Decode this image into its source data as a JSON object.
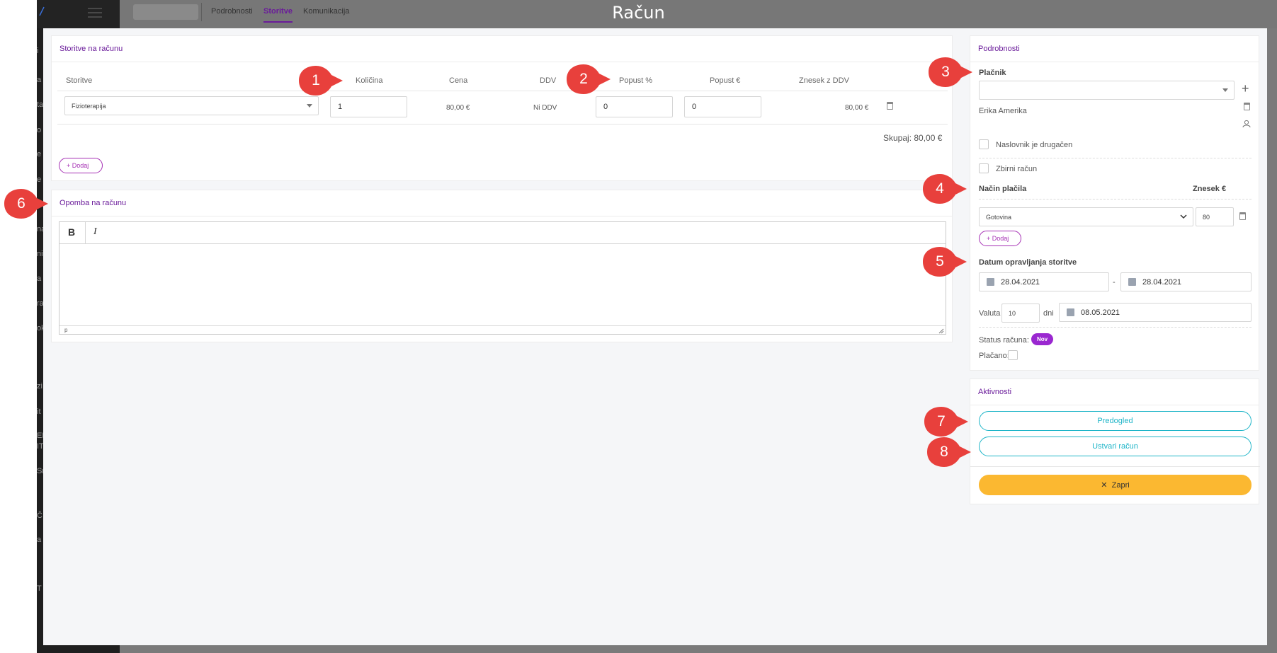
{
  "modal_title": "Račun",
  "background_tabs": [
    "Podrobnosti",
    "Storitve",
    "Komunikacija"
  ],
  "sidebar_fragments": [
    "i",
    "a",
    "ta",
    "o",
    "e",
    "e",
    "na",
    "nik",
    "a",
    "ra",
    "ok",
    "zi",
    "it",
    "ER",
    "IT",
    "Sr",
    "Č",
    "a",
    "T"
  ],
  "services": {
    "title": "Storitve na računu",
    "headers": {
      "service": "Storitve",
      "quantity": "Količina",
      "price": "Cena",
      "vat": "DDV",
      "discount_pct": "Popust %",
      "discount_eur": "Popust €",
      "amount_vat": "Znesek z DDV"
    },
    "row": {
      "service": "Fizioterapija",
      "quantity": "1",
      "price": "80,00 €",
      "vat": "Ni DDV",
      "discount_pct": "0",
      "discount_eur": "0",
      "amount": "80,00 €"
    },
    "total": "Skupaj: 80,00 €",
    "add_label": "Dodaj"
  },
  "note": {
    "title": "Opomba na računu",
    "bold": "B",
    "italic": "I",
    "status_path": "p"
  },
  "details": {
    "title": "Podrobnosti",
    "payer_label": "Plačnik",
    "payer_value": "",
    "payer_name": "Erika Amerika",
    "addressee_label": "Naslovnik je drugačen",
    "collective_label": "Zbirni račun",
    "payment_method_label": "Način plačila",
    "amount_label": "Znesek €",
    "payment_method_value": "Gotovina",
    "amount_value": "80",
    "add_label": "Dodaj",
    "service_date_label": "Datum opravljanja storitve",
    "date_from": "28.04.2021",
    "date_sep": "-",
    "date_to": "28.04.2021",
    "valuta_label": "Valuta",
    "valuta_days": "10",
    "days_label": "dni",
    "due_date": "08.05.2021",
    "status_label": "Status računa:",
    "status_value": "Nov",
    "paid_label": "Plačano:"
  },
  "activities": {
    "title": "Aktivnosti",
    "preview": "Predogled",
    "create": "Ustvari račun",
    "close": "Zapri"
  },
  "markers": [
    "1",
    "2",
    "3",
    "4",
    "5",
    "6",
    "7",
    "8"
  ],
  "colors": {
    "accent": "#6a1b9a",
    "badge": "#9a27d0",
    "outline_button": "#1fb5c8",
    "close_button": "#fbb831",
    "marker": "#e8403c"
  }
}
